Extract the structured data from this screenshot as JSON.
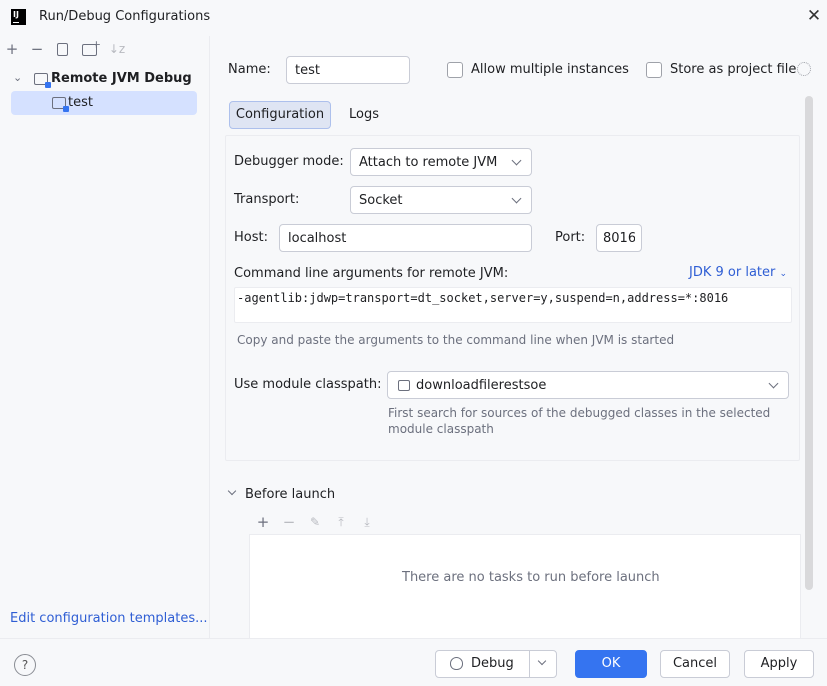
{
  "window": {
    "title": "Run/Debug Configurations",
    "logo_text": "IJ"
  },
  "left": {
    "toolbar": [
      "add-icon",
      "remove-icon",
      "copy-icon",
      "new-folder-icon",
      "sort-icon"
    ],
    "tree_root": "Remote JVM Debug",
    "tree_item": "test",
    "edit_templates": "Edit configuration templates..."
  },
  "form": {
    "name_label": "Name:",
    "name_value": "test",
    "allow_multiple": "Allow multiple instances",
    "store_project": "Store as project file",
    "tabs": {
      "configuration": "Configuration",
      "logs": "Logs"
    },
    "debugger_mode_label": "Debugger mode:",
    "debugger_mode_value": "Attach to remote JVM",
    "transport_label": "Transport:",
    "transport_value": "Socket",
    "host_label": "Host:",
    "host_value": "localhost",
    "port_label": "Port:",
    "port_value": "8016",
    "cmdline_label": "Command line arguments for remote JVM:",
    "jdk_link": "JDK 9 or later",
    "cmdline_value": "-agentlib:jdwp=transport=dt_socket,server=y,suspend=n,address=*:8016",
    "cmdline_hint": "Copy and paste the arguments to the command line when JVM is started",
    "module_label": "Use module classpath:",
    "module_value": "downloadfilerestsoe",
    "module_hint_1": "First search for sources of the debugged classes in the selected",
    "module_hint_2": "module classpath",
    "before_launch": "Before launch",
    "before_launch_empty": "There are no tasks to run before launch"
  },
  "footer": {
    "help": "?",
    "debug": "Debug",
    "ok": "OK",
    "cancel": "Cancel",
    "apply": "Apply"
  }
}
